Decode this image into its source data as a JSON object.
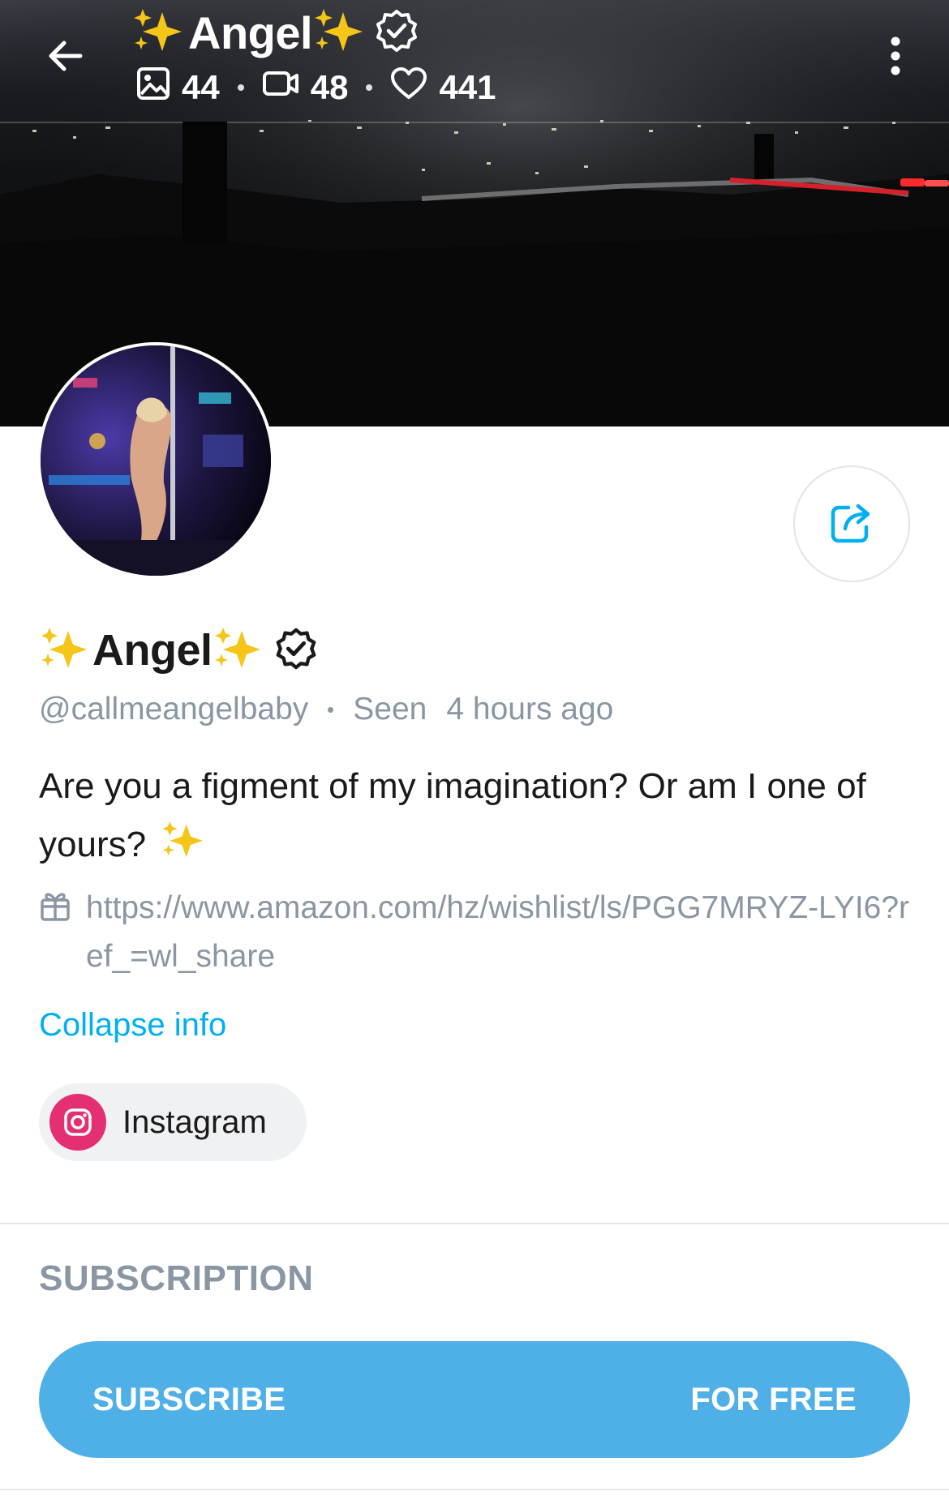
{
  "header": {
    "sparkle_left": "✨",
    "name": "Angel",
    "sparkle_right": "✨",
    "stats": {
      "photos": "44",
      "videos": "48",
      "likes": "441"
    }
  },
  "icons": {
    "back": "arrow-left-icon",
    "more": "more-vertical-icon",
    "verified": "verified-badge-icon",
    "photos": "image-icon",
    "videos": "video-icon",
    "likes": "heart-icon",
    "share": "share-icon",
    "gift": "gift-icon",
    "instagram": "instagram-icon"
  },
  "profile": {
    "sparkle_left": "✨",
    "name": "Angel",
    "sparkle_right": "✨",
    "username": "@callmeangelbaby",
    "seen_label": "Seen",
    "seen_time": "4 hours ago",
    "bio": "Are you a figment of my imagination? Or am I one of yours?",
    "bio_emoji": "✨",
    "wishlist_url": "https://www.amazon.com/hz/wishlist/ls/PGG7MRYZ-LYI6?ref_=wl_share",
    "collapse_label": "Collapse info"
  },
  "social": {
    "instagram_label": "Instagram"
  },
  "subscription": {
    "section_title": "SUBSCRIPTION",
    "subscribe_label": "SUBSCRIBE",
    "price_label": "FOR FREE"
  },
  "colors": {
    "accent": "#00aff0",
    "button": "#4fb0e8",
    "muted": "#8a96a3",
    "instagram": "#e42f73",
    "sparkle": "#f5c518"
  }
}
